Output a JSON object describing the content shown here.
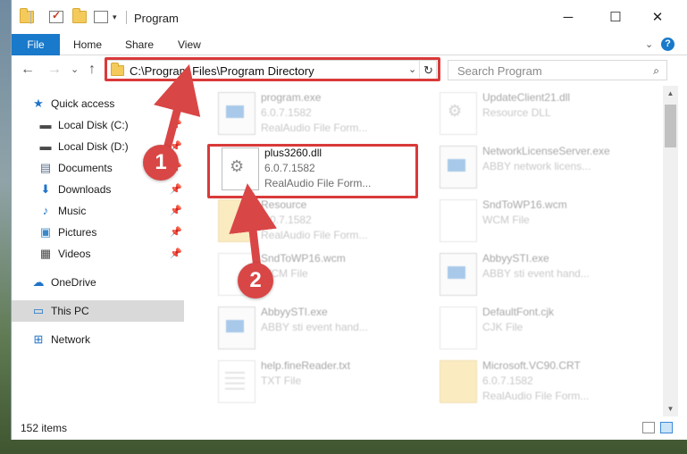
{
  "window": {
    "title": "Program",
    "controls": {
      "minimize": "─",
      "maximize": "☐",
      "close": "✕"
    }
  },
  "ribbon": {
    "tabs": [
      "File",
      "Home",
      "Share",
      "View"
    ],
    "expand_icon": "chevron-down-icon",
    "help": "?"
  },
  "navigation": {
    "back": "←",
    "forward": "→",
    "recent": "⌄",
    "up": "↑",
    "address": "C:\\Program Files\\Program Directory",
    "address_dropdown": "⌄",
    "refresh": "↻",
    "search_placeholder": "Search Program",
    "search_icon": "⌕"
  },
  "sidebar": {
    "items": [
      {
        "label": "Quick access",
        "icon": "star-icon",
        "glyph": "★",
        "color": "#1f73c9",
        "pinned": false
      },
      {
        "label": "Local Disk (C:)",
        "icon": "disk-icon",
        "glyph": "▬",
        "color": "#4a4a4a",
        "pinned": true
      },
      {
        "label": "Local Disk (D:)",
        "icon": "disk-icon",
        "glyph": "▬",
        "color": "#4a4a4a",
        "pinned": true
      },
      {
        "label": "Documents",
        "icon": "documents-icon",
        "glyph": "▤",
        "color": "#5a6e88",
        "pinned": true
      },
      {
        "label": "Downloads",
        "icon": "downloads-icon",
        "glyph": "⬇",
        "color": "#1f73c9",
        "pinned": true
      },
      {
        "label": "Music",
        "icon": "music-icon",
        "glyph": "♪",
        "color": "#1f73c9",
        "pinned": true
      },
      {
        "label": "Pictures",
        "icon": "pictures-icon",
        "glyph": "▣",
        "color": "#3a88c8",
        "pinned": true
      },
      {
        "label": "Videos",
        "icon": "videos-icon",
        "glyph": "▦",
        "color": "#444444",
        "pinned": true
      },
      {
        "label": "OneDrive",
        "icon": "onedrive-icon",
        "glyph": "☁",
        "color": "#1f73c9",
        "pinned": false
      },
      {
        "label": "This PC",
        "icon": "this-pc-icon",
        "glyph": "▭",
        "color": "#1f73c9",
        "pinned": false,
        "selected": true
      },
      {
        "label": "Network",
        "icon": "network-icon",
        "glyph": "⊞",
        "color": "#1f73c9",
        "pinned": false
      }
    ],
    "pin_glyph": "📌"
  },
  "files": [
    {
      "name": "program.exe",
      "version": "6.0.7.1582",
      "type": "RealAudio File Form...",
      "icon": "exe-icon",
      "faded": true
    },
    {
      "name": "UpdateClient21.dll",
      "version": "",
      "type": "Resource DLL",
      "icon": "dll-icon",
      "faded": true
    },
    {
      "name": "plus3260.dll",
      "version": "6.0.7.1582",
      "type": "RealAudio File Form...",
      "icon": "dll-icon",
      "faded": false
    },
    {
      "name": "NetworkLicenseServer.exe",
      "version": "ABBY network licens...",
      "type": "",
      "icon": "exe-icon",
      "faded": true
    },
    {
      "name": "Resource",
      "version": "6.0.7.1582",
      "type": "RealAudio File Form...",
      "icon": "folder-icon",
      "faded": true
    },
    {
      "name": "SndToWP16.wcm",
      "version": "WCM File",
      "type": "",
      "icon": "file-icon",
      "faded": true
    },
    {
      "name": "SndToWP16.wcm",
      "version": "WCM File",
      "type": "",
      "icon": "file-icon",
      "faded": true
    },
    {
      "name": "AbbyySTI.exe",
      "version": "ABBY sti event hand...",
      "type": "",
      "icon": "exe-icon",
      "faded": true
    },
    {
      "name": "AbbyySTI.exe",
      "version": "ABBY sti event hand...",
      "type": "",
      "icon": "exe-icon",
      "faded": true
    },
    {
      "name": "DefaultFont.cjk",
      "version": "CJK File",
      "type": "",
      "icon": "file-icon",
      "faded": true
    },
    {
      "name": "help.fineReader.txt",
      "version": "TXT File",
      "type": "",
      "icon": "txt-icon",
      "faded": true
    },
    {
      "name": "Microsoft.VC90.CRT",
      "version": "6.0.7.1582",
      "type": "RealAudio File Form...",
      "icon": "folder-icon",
      "faded": true
    }
  ],
  "status": {
    "items_count": "152 items"
  },
  "annotations": {
    "step1": "1",
    "step2": "2",
    "highlight_color": "#d93a3a"
  }
}
